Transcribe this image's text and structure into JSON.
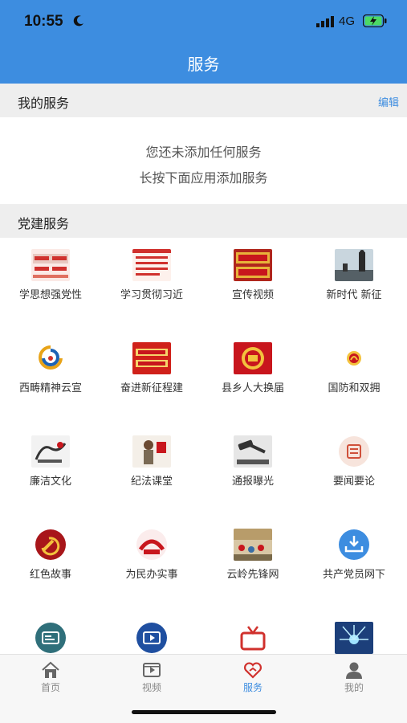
{
  "status": {
    "time": "10:55",
    "network": "4G"
  },
  "header": {
    "title": "服务"
  },
  "my_services": {
    "label": "我的服务",
    "edit_label": "编辑",
    "empty_line1": "您还未添加任何服务",
    "empty_line2": "长按下面应用添加服务"
  },
  "party_services": {
    "label": "党建服务",
    "items": [
      {
        "label": "学思想强党性",
        "icon": "banner-slogan-icon"
      },
      {
        "label": "学习贯彻习近",
        "icon": "banner-study-icon"
      },
      {
        "label": "宣传视频",
        "icon": "promo-video-icon"
      },
      {
        "label": "新时代 新征",
        "icon": "new-era-icon"
      },
      {
        "label": "西畴精神云宣",
        "icon": "xichou-logo-icon"
      },
      {
        "label": "奋进新征程建",
        "icon": "new-journey-banner-icon"
      },
      {
        "label": "县乡人大换届",
        "icon": "national-emblem-icon"
      },
      {
        "label": "国防和双拥",
        "icon": "defense-emblem-icon"
      },
      {
        "label": "廉洁文化",
        "icon": "integrity-culture-icon"
      },
      {
        "label": "纪法课堂",
        "icon": "discipline-class-icon"
      },
      {
        "label": "通报曝光",
        "icon": "gavel-icon"
      },
      {
        "label": "要闻要论",
        "icon": "news-icon"
      },
      {
        "label": "红色故事",
        "icon": "party-emblem-icon"
      },
      {
        "label": "为民办实事",
        "icon": "serve-people-icon"
      },
      {
        "label": "云岭先锋网",
        "icon": "yunling-pioneer-icon"
      },
      {
        "label": "共产党员网下",
        "icon": "download-tray-icon"
      },
      {
        "label": "",
        "icon": "tv-screen-icon"
      },
      {
        "label": "",
        "icon": "video-play-icon"
      },
      {
        "label": "",
        "icon": "retro-tv-icon"
      },
      {
        "label": "",
        "icon": "light-burst-icon"
      }
    ]
  },
  "tabbar": {
    "items": [
      {
        "label": "首页",
        "icon": "home-icon",
        "active": false
      },
      {
        "label": "视频",
        "icon": "video-icon",
        "active": false
      },
      {
        "label": "服务",
        "icon": "service-heart-icon",
        "active": true
      },
      {
        "label": "我的",
        "icon": "profile-icon",
        "active": false
      }
    ]
  },
  "colors": {
    "accent": "#3d8de0",
    "party_red": "#c8161d"
  }
}
